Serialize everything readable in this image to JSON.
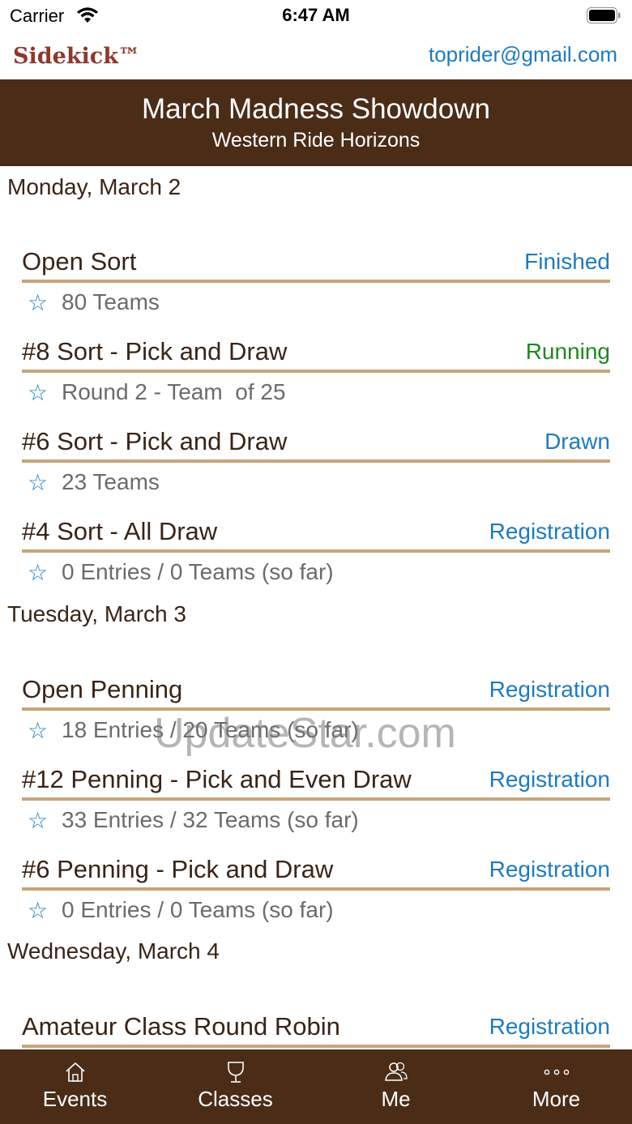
{
  "status_bar": {
    "carrier": "Carrier",
    "time": "6:47 AM"
  },
  "header": {
    "brand": "Sidekick™",
    "user_email": "toprider@gmail.com"
  },
  "event": {
    "title": "March Madness Showdown",
    "subtitle": "Western Ride Horizons"
  },
  "days": [
    {
      "label": "Monday, March 2",
      "classes": [
        {
          "name": "Open Sort",
          "status": "Finished",
          "status_color": "#1e7bbd",
          "detail": "80 Teams"
        },
        {
          "name": "#8 Sort - Pick and Draw",
          "status": "Running",
          "status_color": "#1d8a1d",
          "detail": "Round 2 - Team  of 25"
        },
        {
          "name": "#6 Sort - Pick and Draw",
          "status": "Drawn",
          "status_color": "#1e7bbd",
          "detail": "23 Teams"
        },
        {
          "name": "#4 Sort - All Draw",
          "status": "Registration",
          "status_color": "#1e7bbd",
          "detail": "0 Entries / 0 Teams (so far)"
        }
      ]
    },
    {
      "label": "Tuesday, March 3",
      "classes": [
        {
          "name": "Open Penning",
          "status": "Registration",
          "status_color": "#1e7bbd",
          "detail": "18 Entries / 20 Teams (so far)"
        },
        {
          "name": "#12 Penning - Pick and Even Draw",
          "status": "Registration",
          "status_color": "#1e7bbd",
          "detail": "33 Entries / 32 Teams (so far)"
        },
        {
          "name": "#6 Penning - Pick and Draw",
          "status": "Registration",
          "status_color": "#1e7bbd",
          "detail": "0 Entries / 0 Teams (so far)"
        }
      ]
    },
    {
      "label": "Wednesday, March 4",
      "classes": [
        {
          "name": "Amateur Class Round Robin",
          "status": "Registration",
          "status_color": "#1e7bbd",
          "detail": ""
        }
      ]
    }
  ],
  "watermark": "UpdateStar.com",
  "tabs": [
    {
      "label": "Events",
      "icon": "home-icon"
    },
    {
      "label": "Classes",
      "icon": "trophy-icon"
    },
    {
      "label": "Me",
      "icon": "users-icon"
    },
    {
      "label": "More",
      "icon": "more-icon"
    }
  ],
  "colors": {
    "banner": "#4a2c17",
    "brand": "#8b3a2f",
    "link_blue": "#1e7bbd",
    "running_green": "#1d8a1d",
    "divider": "#c9a47a"
  }
}
